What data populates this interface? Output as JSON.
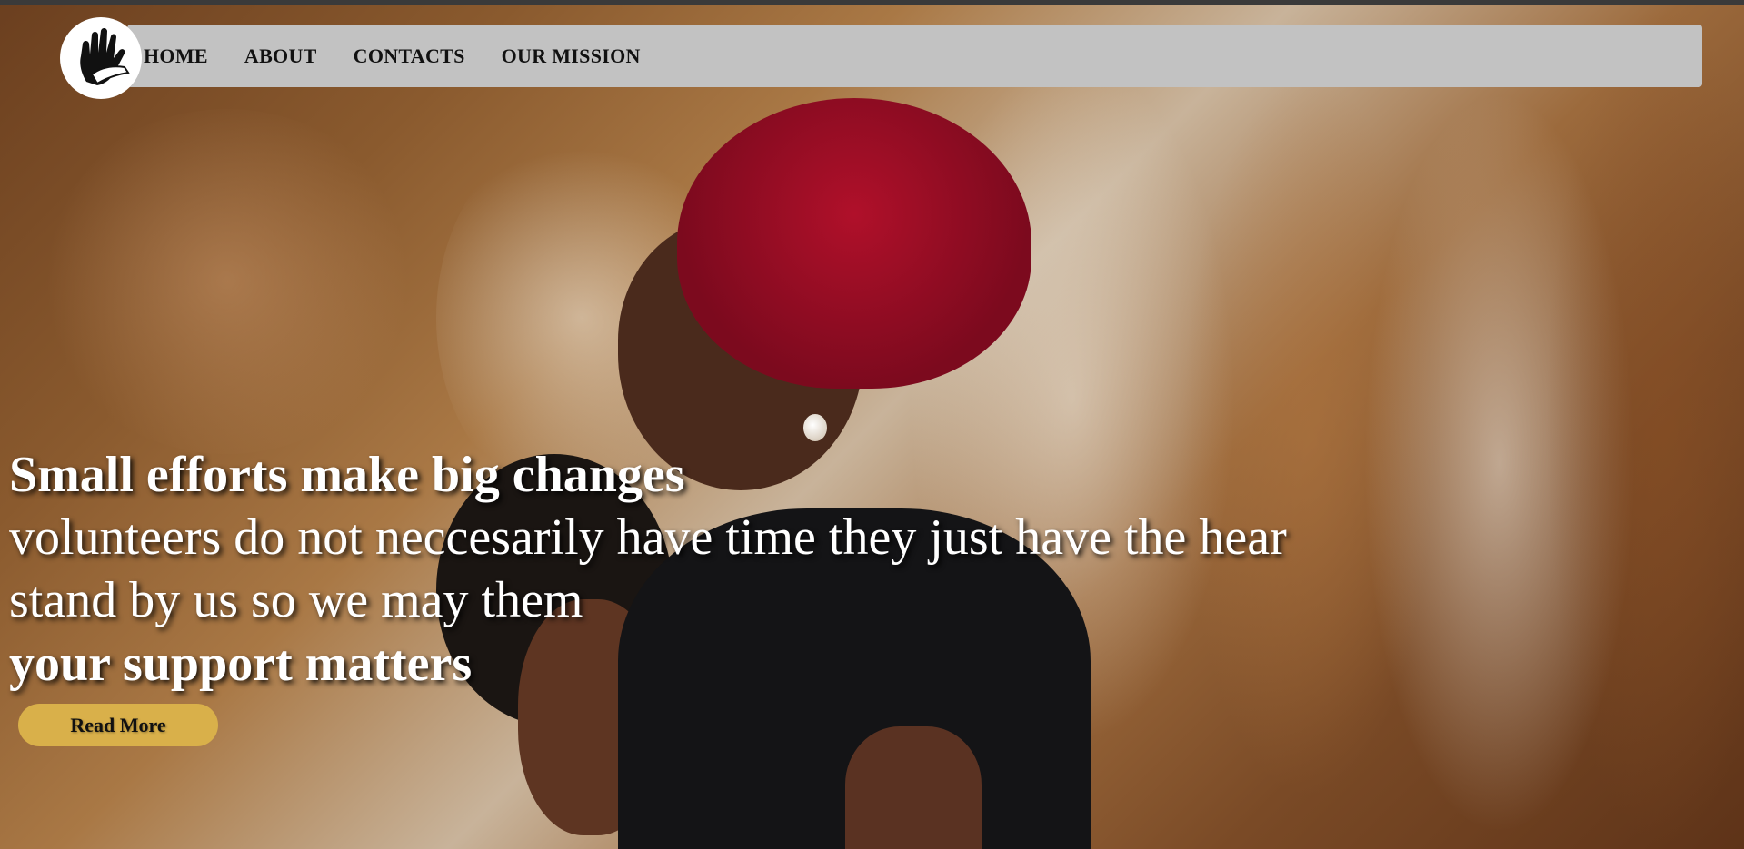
{
  "nav": {
    "logo_icon": "raised-hand-logo-icon",
    "links": [
      {
        "label": "HOME"
      },
      {
        "label": "ABOUT"
      },
      {
        "label": "CONTACTS"
      },
      {
        "label": "OUR MISSION"
      }
    ]
  },
  "hero": {
    "headline": "Small efforts make big changes",
    "line1": "volunteers do not neccesarily have time they just have the hear",
    "line2": "stand by us so we may them",
    "tagline": "your support matters",
    "button_label": "Read More"
  },
  "colors": {
    "navbar": "#c2c2c2",
    "button": "#d9b04a",
    "text": "#ffffff"
  }
}
